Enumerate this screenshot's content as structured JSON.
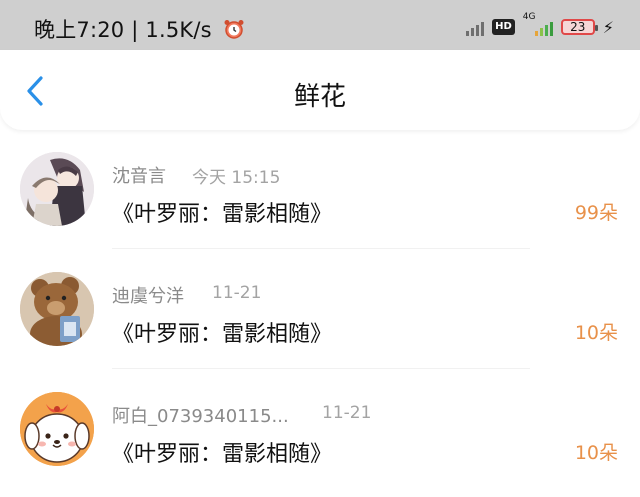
{
  "status_bar": {
    "time": "晚上7:20",
    "speed": "1.5K/s",
    "hd": "HD",
    "net": "4G",
    "battery": "23"
  },
  "nav": {
    "title": "鲜花"
  },
  "items": [
    {
      "name": "沈音言",
      "time": "今天 15:15",
      "book": "《叶罗丽：雷影相随》",
      "count": "99朵"
    },
    {
      "name": "迪虞兮洋",
      "time": "11-21",
      "book": "《叶罗丽：雷影相随》",
      "count": "10朵"
    },
    {
      "name": "阿白_0739340115...",
      "time": "11-21",
      "book": "《叶罗丽：雷影相随》",
      "count": "10朵"
    }
  ],
  "colors": {
    "accent_blue": "#2a90e8",
    "count_orange": "#e8914a",
    "status_bar_bg": "#cfcfcf"
  }
}
